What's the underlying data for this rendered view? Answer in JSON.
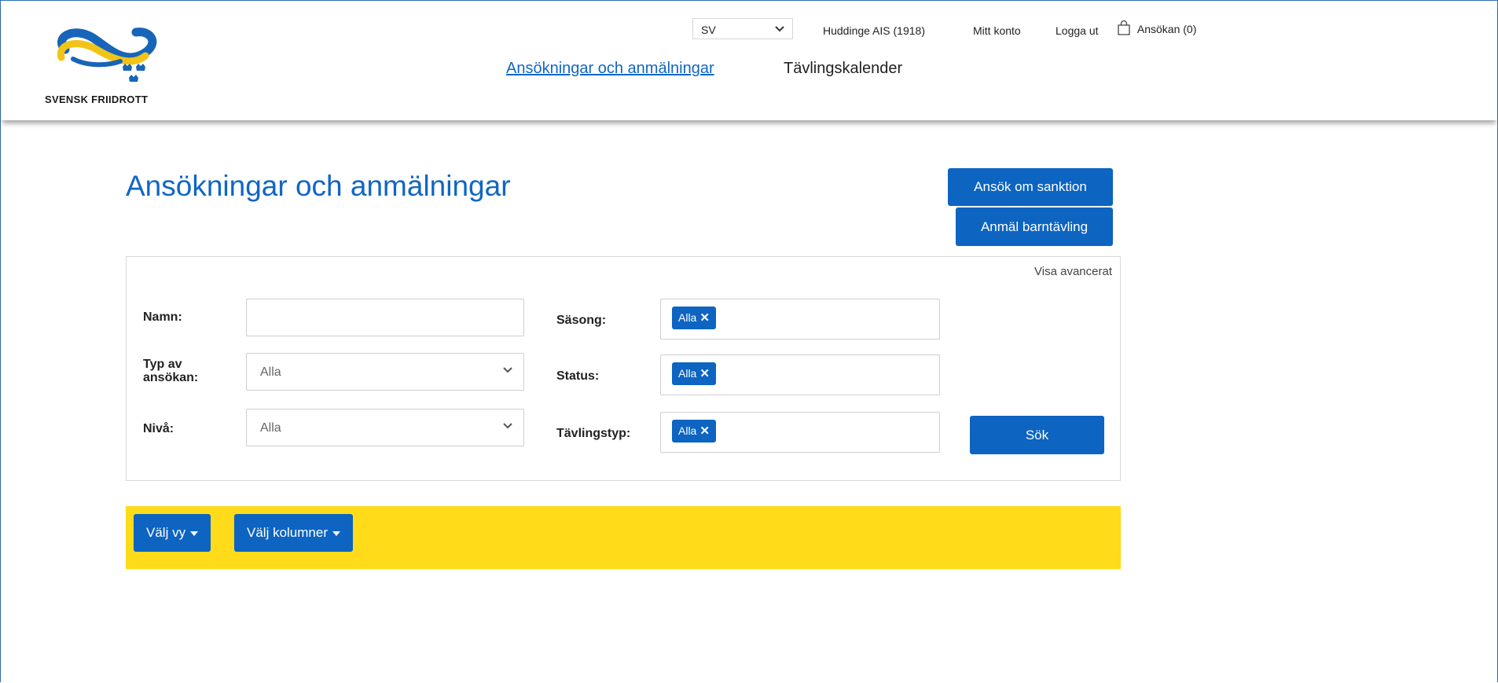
{
  "brand": {
    "logo_text": "SVENSK FRIIDROTT"
  },
  "topbar": {
    "language": "SV",
    "club": "Huddinge AIS (1918)",
    "account": "Mitt konto",
    "logout": "Logga ut",
    "cart": "Ansökan (0)"
  },
  "nav": {
    "applications": "Ansökningar och anmälningar",
    "calendar": "Tävlingskalender"
  },
  "page": {
    "title": "Ansökningar och anmälningar",
    "apply_sanction": "Ansök om sanktion",
    "register_kids": "Anmäl barntävling"
  },
  "filters": {
    "advanced_link": "Visa avancerat",
    "name_label": "Namn:",
    "name_value": "",
    "type_label": "Typ av ansökan:",
    "type_value": "Alla",
    "level_label": "Nivå:",
    "level_value": "Alla",
    "season_label": "Säsong:",
    "season_tag": "Alla",
    "status_label": "Status:",
    "status_tag": "Alla",
    "comptype_label": "Tävlingstyp:",
    "comptype_tag": "Alla",
    "search_button": "Sök"
  },
  "toolbar": {
    "view": "Välj vy",
    "columns": "Välj kolumner"
  },
  "colors": {
    "accent": "#0d64c1",
    "title_blue": "#1066c5",
    "toolbar_yellow": "#ffdb1a"
  }
}
